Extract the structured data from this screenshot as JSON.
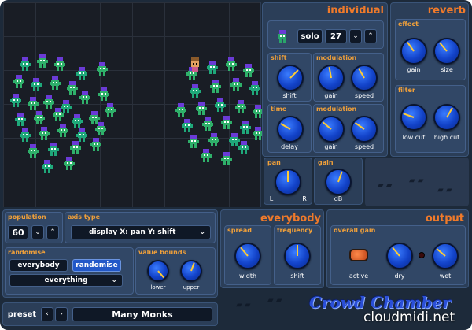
{
  "individual": {
    "title": "individual",
    "solo_label": "solo",
    "voice_number": "27",
    "shift": {
      "label": "shift",
      "knob_label": "shift"
    },
    "modulation1": {
      "label": "modulation",
      "gain_label": "gain",
      "speed_label": "speed"
    },
    "time": {
      "label": "time",
      "knob_label": "delay"
    },
    "modulation2": {
      "label": "modulation",
      "gain_label": "gain",
      "speed_label": "speed"
    },
    "pan": {
      "label": "pan",
      "left_label": "L",
      "right_label": "R"
    },
    "gain": {
      "label": "gain",
      "knob_label": "dB"
    }
  },
  "reverb": {
    "title": "reverb",
    "effect": {
      "label": "effect",
      "gain_label": "gain",
      "size_label": "size"
    },
    "filter": {
      "label": "filter",
      "low_cut_label": "low cut",
      "high_cut_label": "high cut"
    }
  },
  "population": {
    "label": "population",
    "value": "60"
  },
  "axis_type": {
    "label": "axis type",
    "value": "display  X: pan   Y: shift"
  },
  "randomise": {
    "label": "randomise",
    "target": "everybody",
    "button": "randomise",
    "scope": "everything"
  },
  "value_bounds": {
    "label": "value bounds",
    "lower_label": "lower",
    "upper_label": "upper"
  },
  "everybody": {
    "title": "everybody",
    "spread": {
      "label": "spread",
      "knob_label": "width"
    },
    "frequency": {
      "label": "frequency",
      "knob_label": "shift"
    }
  },
  "output": {
    "title": "output",
    "overall_gain_label": "overall gain",
    "active_label": "active",
    "dry_label": "dry",
    "wet_label": "wet"
  },
  "preset": {
    "label": "preset",
    "name": "Many Monks"
  },
  "brand": "Crowd Chamber",
  "watermark": "cloudmidi.net",
  "colors": {
    "accent_orange": "#f07a2a",
    "label_gold": "#f0a03a",
    "knob_blue": "#1242c8",
    "panel": "#2b3e58",
    "stage": "#191d25"
  }
}
